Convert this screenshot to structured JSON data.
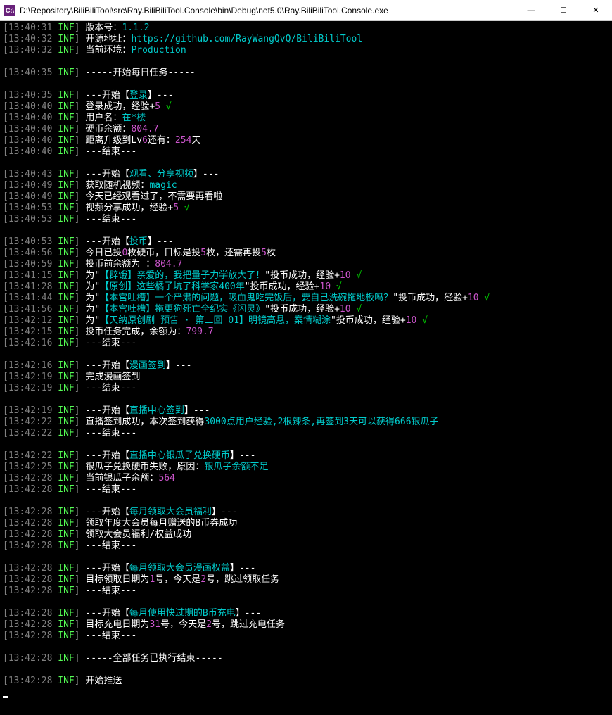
{
  "window": {
    "icon_label": "C:\\",
    "title": "D:\\Repository\\BiliBiliTool\\src\\Ray.BiliBiliTool.Console\\bin\\Debug\\net5.0\\Ray.BiliBiliTool.Console.exe",
    "min": "—",
    "max": "☐",
    "close": "✕"
  },
  "ts": {
    "t1": "13:40:31",
    "t2": "13:40:32",
    "t3": "13:40:32",
    "t4": "13:40:35",
    "t5": "13:40:35",
    "t6": "13:40:40",
    "t7": "13:40:40",
    "t8": "13:40:40",
    "t9": "13:40:40",
    "t10": "13:40:40",
    "t11": "13:40:43",
    "t12": "13:40:49",
    "t13": "13:40:49",
    "t14": "13:40:53",
    "t15": "13:40:53",
    "t16": "13:40:53",
    "t17": "13:40:56",
    "t18": "13:40:59",
    "t19": "13:41:15",
    "t20": "13:41:28",
    "t21": "13:41:44",
    "t22": "13:41:56",
    "t23": "13:42:12",
    "t24": "13:42:15",
    "t25": "13:42:16",
    "t26": "13:42:16",
    "t27": "13:42:19",
    "t28": "13:42:19",
    "t29": "13:42:19",
    "t30": "13:42:22",
    "t31": "13:42:22",
    "t32": "13:42:22",
    "t33": "13:42:25",
    "t34": "13:42:28",
    "t35": "13:42:28",
    "t36": "13:42:28",
    "t37": "13:42:28",
    "t38": "13:42:28",
    "t39": "13:42:28",
    "t40": "13:42:28",
    "t41": "13:42:28",
    "t42": "13:42:28",
    "t43": "13:42:28",
    "t44": "13:42:28",
    "t45": "13:42:28",
    "t46": "13:42:28",
    "t47": "13:42:28"
  },
  "lvl": "INF",
  "txt": {
    "version_label": "版本号：",
    "version_val": "1.1.2",
    "opensrc_label": "开源地址：",
    "opensrc_url": "https://github.com/RayWangQvQ/BiliBiliTool",
    "env_label": "当前环境：",
    "env_val": "Production",
    "daily_start": "-----开始每日任务-----",
    "sec_login_a": "---开始【",
    "sec_login_b": "登录",
    "sec_login_c": "】---",
    "login_ok_a": "登录成功，经验+",
    "login_ok_b": "5",
    "check": " √",
    "user_a": "用户名：",
    "user_b": "在*楼",
    "coin_a": "硬币余额：",
    "coin_b": "804.7",
    "lvup_a": "距离升级到Lv",
    "lvup_b": "6",
    "lvup_c": "还有：",
    "lvup_d": "254",
    "lvup_e": "天",
    "end": "---结束---",
    "sec_watch_a": "---开始【",
    "sec_watch_b": "观看、分享视频",
    "sec_watch_c": "】---",
    "rand_a": "获取随机视频：",
    "rand_b": "magic",
    "watched": "今天已经观看过了，不需要再看啦",
    "share_a": "视频分享成功，经验+",
    "share_b": "5",
    "sec_coin_a": "---开始【",
    "sec_coin_b": "投币",
    "sec_coin_c": "】---",
    "today_a": "今日已投",
    "today_b": "0",
    "today_c": "枚硬币，目标是投",
    "today_d": "5",
    "today_e": "枚，还需再投",
    "today_f": "5",
    "today_g": "枚",
    "bal_a": "投币前余额为 ：",
    "bal_b": "804.7",
    "v1_a": "为\"",
    "v1_b": "【辟饿】亲爱的，我把量子力学放大了！",
    "v1_c": "\"投币成功，经验+",
    "v1_d": "10",
    "v2_a": "为\"",
    "v2_b": "【原创】这些橘子坑了科学家400年",
    "v2_c": "\"投币成功，经验+",
    "v2_d": "10",
    "v3_a": "为\"",
    "v3_b": "【本宫吐槽】一个严肃的问题，吸血鬼吃完饭后，要自己洗碗拖地板吗？",
    "v3_c": "\"投币成功，经验+",
    "v3_d": "10",
    "v4_a": "为\"",
    "v4_b": "【本宫吐槽】拖更狗死亡全纪实《闪灵》",
    "v4_c": "\"投币成功，经验+",
    "v4_d": "10",
    "v5_a": "为\"",
    "v5_b": "【天纳原创剧 预告 · 第二回 01】明镜高悬，案情糊涂",
    "v5_c": "\"投币成功，经验+",
    "v5_d": "10",
    "coindone_a": "投币任务完成，余额为：",
    "coindone_b": "799.7",
    "sec_manga_a": "---开始【",
    "sec_manga_b": "漫画签到",
    "sec_manga_c": "】---",
    "manga_done": "完成漫画签到",
    "sec_live_a": "---开始【",
    "sec_live_b": "直播中心签到",
    "sec_live_c": "】---",
    "live_a": "直播签到成功，本次签到获得",
    "live_b": "3000点用户经验,2根辣条,再签到3天可以获得666银瓜子",
    "sec_silver_a": "---开始【",
    "sec_silver_b": "直播中心银瓜子兑换硬币",
    "sec_silver_c": "】---",
    "silver_a": "银瓜子兑换硬币失败，原因：",
    "silver_b": "银瓜子余额不足",
    "silverbal_a": "当前银瓜子余额：",
    "silverbal_b": "564",
    "sec_vip_a": "---开始【",
    "sec_vip_b": "每月领取大会员福利",
    "sec_vip_c": "】---",
    "vip1": "领取年度大会员每月赠送的B币券成功",
    "vip2": "领取大会员福利/权益成功",
    "sec_vipmanga_a": "---开始【",
    "sec_vipmanga_b": "每月领取大会员漫画权益",
    "sec_vipmanga_c": "】---",
    "vm_a": "目标领取日期为",
    "vm_b": "1",
    "vm_c": "号，今天是",
    "vm_d": "2",
    "vm_e": "号，跳过领取任务",
    "sec_charge_a": "---开始【",
    "sec_charge_b": "每月使用快过期的B币充电",
    "sec_charge_c": "】---",
    "ch_a": "目标充电日期为",
    "ch_b": "31",
    "ch_c": "号，今天是",
    "ch_d": "2",
    "ch_e": "号，跳过充电任务",
    "all_done": "-----全部任务已执行结束-----",
    "push": "开始推送"
  }
}
